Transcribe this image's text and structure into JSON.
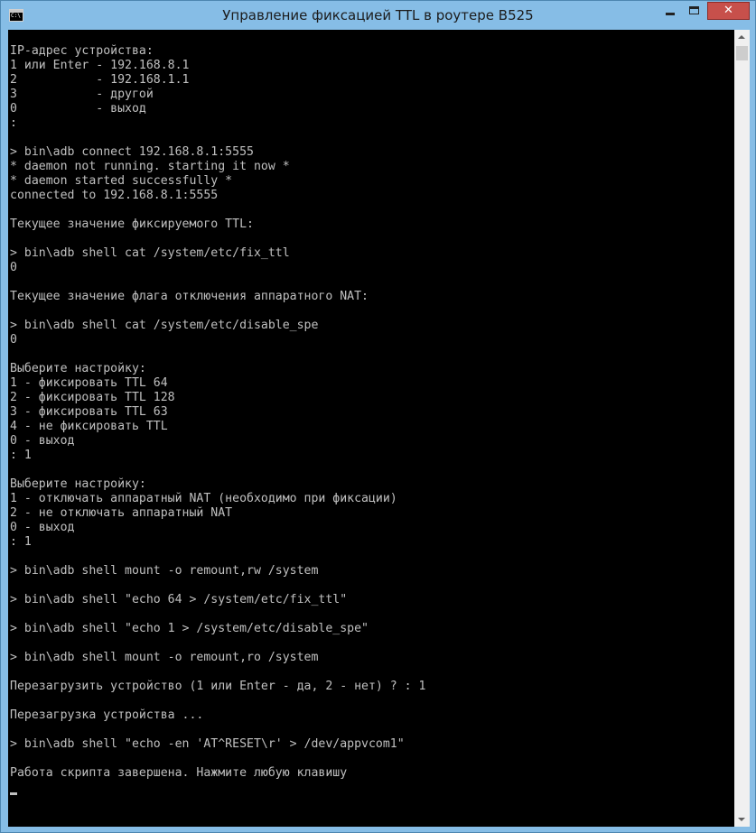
{
  "window": {
    "title": "Управление фиксацией TTL в роутере B525",
    "close_symbol": "✕"
  },
  "console": {
    "lines": [
      "IP-адрес устройства:",
      "1 или Enter - 192.168.8.1",
      "2           - 192.168.1.1",
      "3           - другой",
      "0           - выход",
      ":",
      "",
      "> bin\\adb connect 192.168.8.1:5555",
      "* daemon not running. starting it now *",
      "* daemon started successfully *",
      "connected to 192.168.8.1:5555",
      "",
      "Текущее значение фиксируемого TTL:",
      "",
      "> bin\\adb shell cat /system/etc/fix_ttl",
      "0",
      "",
      "Текущее значение флага отключения аппаратного NAT:",
      "",
      "> bin\\adb shell cat /system/etc/disable_spe",
      "0",
      "",
      "Выберите настройку:",
      "1 - фиксировать TTL 64",
      "2 - фиксировать TTL 128",
      "3 - фиксировать TTL 63",
      "4 - не фиксировать TTL",
      "0 - выход",
      ": 1",
      "",
      "Выберите настройку:",
      "1 - отключать аппаратный NAT (необходимо при фиксации)",
      "2 - не отключать аппаратный NAT",
      "0 - выход",
      ": 1",
      "",
      "> bin\\adb shell mount -o remount,rw /system",
      "",
      "> bin\\adb shell \"echo 64 > /system/etc/fix_ttl\"",
      "",
      "> bin\\adb shell \"echo 1 > /system/etc/disable_spe\"",
      "",
      "> bin\\adb shell mount -o remount,ro /system",
      "",
      "Перезагрузить устройство (1 или Enter - да, 2 - нет) ? : 1",
      "",
      "Перезагрузка устройства ...",
      "",
      "> bin\\adb shell \"echo -en 'AT^RESET\\r' > /dev/appvcom1\"",
      "",
      "Работа скрипта завершена. Нажмите любую клавишу"
    ]
  },
  "colors": {
    "console_background": "#000000",
    "console_text": "#c0c0c0",
    "titlebar": "#86bde6",
    "close_button": "#c7504b"
  }
}
